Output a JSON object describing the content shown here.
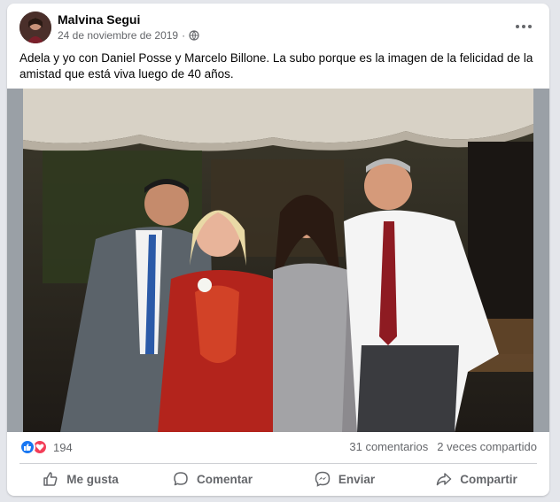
{
  "post": {
    "author": "Malvina Segui",
    "date": "24 de noviembre de 2019",
    "separator": "·",
    "privacy_icon": "globe-icon",
    "more_icon": "more-horizontal-icon",
    "text": "Adela y yo con Daniel Posse y Marcelo Billone. La subo porque es la imagen de la felicidad de la amistad que está viva luego de 40 años."
  },
  "stats": {
    "reaction_icons": [
      "like-icon",
      "love-icon"
    ],
    "reaction_count": "194",
    "comments": "31 comentarios",
    "shares": "2 veces compartido"
  },
  "actions": {
    "like": "Me gusta",
    "comment": "Comentar",
    "send": "Enviar",
    "share": "Compartir"
  },
  "colors": {
    "brand_blue": "#1877f2",
    "love_red": "#f33e58",
    "secondary_text": "#65676b"
  }
}
